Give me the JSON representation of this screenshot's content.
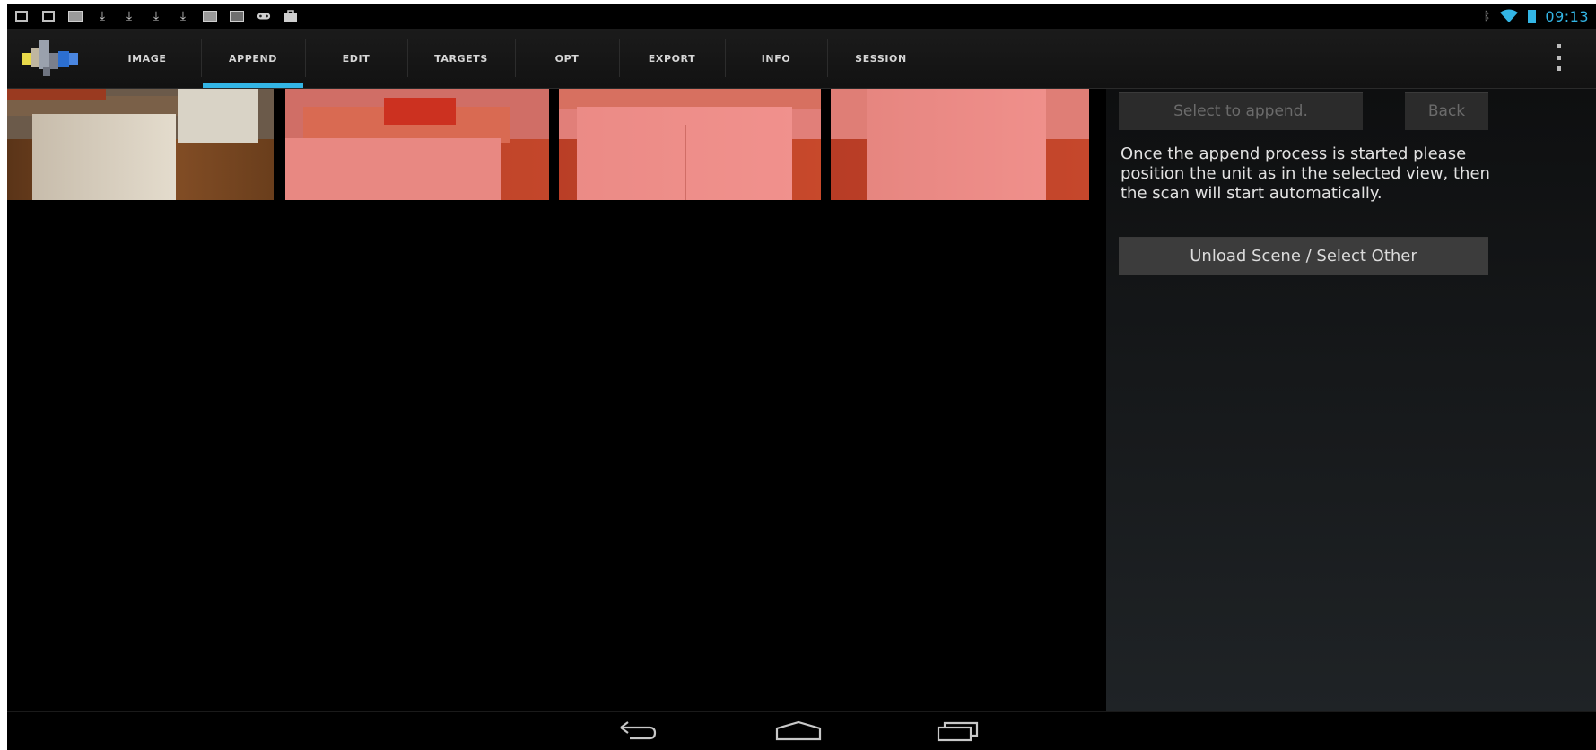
{
  "status_bar": {
    "left_icons": [
      "notification-icon",
      "notification-icon",
      "image-icon",
      "download-icon",
      "download-icon",
      "download-icon",
      "download-icon",
      "image-icon",
      "gallery-icon",
      "gamepad-icon",
      "briefcase-icon"
    ],
    "time": "09:13",
    "accent": "#33b5e5"
  },
  "action_bar": {
    "tabs": [
      {
        "label": "IMAGE",
        "selected": false
      },
      {
        "label": "APPEND",
        "selected": true
      },
      {
        "label": "EDIT",
        "selected": false
      },
      {
        "label": "TARGETS",
        "selected": false
      },
      {
        "label": "OPT",
        "selected": false
      },
      {
        "label": "EXPORT",
        "selected": false
      },
      {
        "label": "INFO",
        "selected": false
      },
      {
        "label": "SESSION",
        "selected": false
      }
    ],
    "overflow_icon": "overflow-menu-icon"
  },
  "thumbnails": [
    {
      "tinted": false
    },
    {
      "tinted": true
    },
    {
      "tinted": true
    },
    {
      "tinted": true
    }
  ],
  "panel": {
    "select_to_append_label": "Select to append.",
    "back_label": "Back",
    "instructions": "Once the append process is started please position the unit as in the selected view, then the scan will start automatically.",
    "unload_label": "Unload Scene / Select Other"
  },
  "nav_bar": {
    "buttons": [
      "back-icon",
      "home-icon",
      "recents-icon"
    ]
  }
}
